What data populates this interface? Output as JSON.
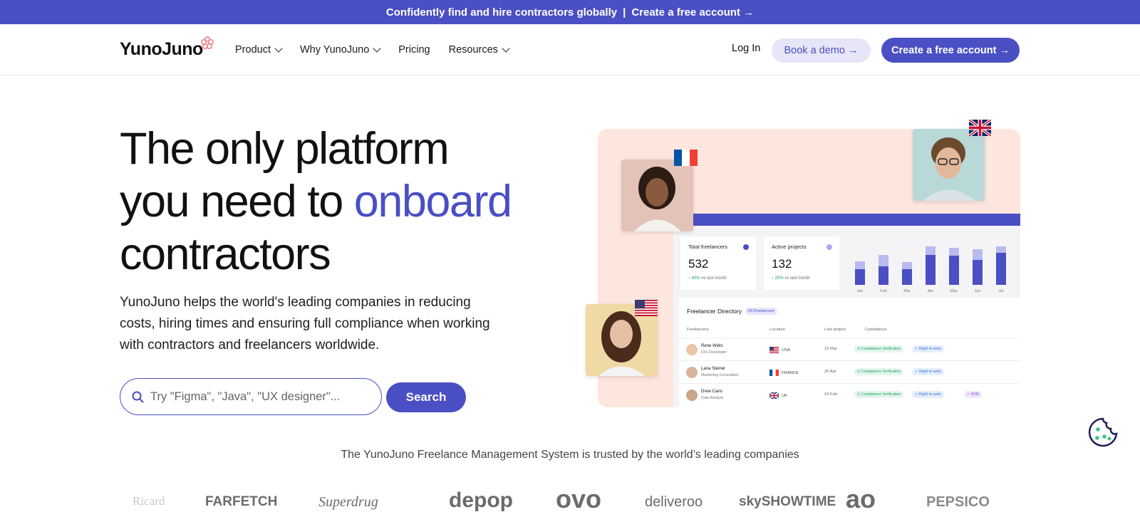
{
  "banner": {
    "text": "Confidently find and hire contractors globally",
    "separator": "|",
    "link": "Create a free account →"
  },
  "nav": {
    "logo": "YunoJuno",
    "links": [
      {
        "label": "Product",
        "has_dropdown": true
      },
      {
        "label": "Why YunoJuno",
        "has_dropdown": true
      },
      {
        "label": "Pricing",
        "has_dropdown": false
      },
      {
        "label": "Resources",
        "has_dropdown": true
      }
    ],
    "login": "Log In",
    "demo_button": "Book a demo →",
    "create_button": "Create a free account →"
  },
  "hero": {
    "title_line1": "The only platform",
    "title_line2_pre": "you need to ",
    "title_accent": "onboard",
    "title_line3": "contractors",
    "subtitle": "YunoJuno helps the world's leading companies in reducing costs, hiring times and ensuring full compliance when working with contractors and freelancers worldwide.",
    "search_placeholder": "Try \"Figma\", \"Java\", \"UX designer\"...",
    "search_button": "Search"
  },
  "dashboard": {
    "stats": [
      {
        "label": "Total freelancers",
        "value": "532",
        "trend": "40%",
        "trend_suffix": "vs last month",
        "dot_color": "#4a4fc4"
      },
      {
        "label": "Active projects",
        "value": "132",
        "trend": "20%",
        "trend_suffix": "vs last month",
        "dot_color": "#a9abf0"
      }
    ],
    "months": [
      "Jan",
      "Feb",
      "Mar",
      "Apr",
      "May",
      "Jun",
      "Jul"
    ],
    "bar_levels": [
      {
        "base": 0.32,
        "total": 0.48
      },
      {
        "base": 0.38,
        "total": 0.62
      },
      {
        "base": 0.32,
        "total": 0.46
      },
      {
        "base": 0.62,
        "total": 0.8
      },
      {
        "base": 0.6,
        "total": 0.76
      },
      {
        "base": 0.52,
        "total": 0.74
      },
      {
        "base": 0.66,
        "total": 0.79
      }
    ],
    "directory": {
      "title": "Freelancer Directory",
      "badge": "64 Freelancers",
      "columns": [
        "Freelancers",
        "Location",
        "Last project",
        "Compliance"
      ],
      "rows": [
        {
          "name": "Rene Wells",
          "role": "iOS Developer",
          "location": "USA",
          "last_project": "22 Mar",
          "tags": [
            "Compliance Verification",
            "Right to work"
          ]
        },
        {
          "name": "Lana Steiner",
          "role": "Marketing Consultant",
          "location": "FRANCE",
          "last_project": "20 Apr",
          "tags": [
            "Compliance Verification",
            "Right to work"
          ]
        },
        {
          "name": "Drew Cano",
          "role": "Data Analyst",
          "location": "UK",
          "last_project": "24 Feb",
          "tags": [
            "Compliance Verification",
            "Right to work",
            "IR35"
          ]
        }
      ]
    }
  },
  "trusted": {
    "text": "The YunoJuno Freelance Management System is trusted by the world’s leading companies",
    "logos": [
      "Ricard",
      "FARFETCH",
      "Superdrug",
      "depop",
      "ovo",
      "deliveroo",
      "skySHOWTIME",
      "ao",
      "PEPSICO"
    ]
  },
  "colors": {
    "brand": "#4a4fc4",
    "brand_light": "#e6e6f8",
    "peach": "#fde6dd"
  },
  "icons": [
    "chevron-down-icon",
    "search-icon",
    "arrow-up-icon",
    "cookie-icon",
    "flower-logo-icon"
  ]
}
